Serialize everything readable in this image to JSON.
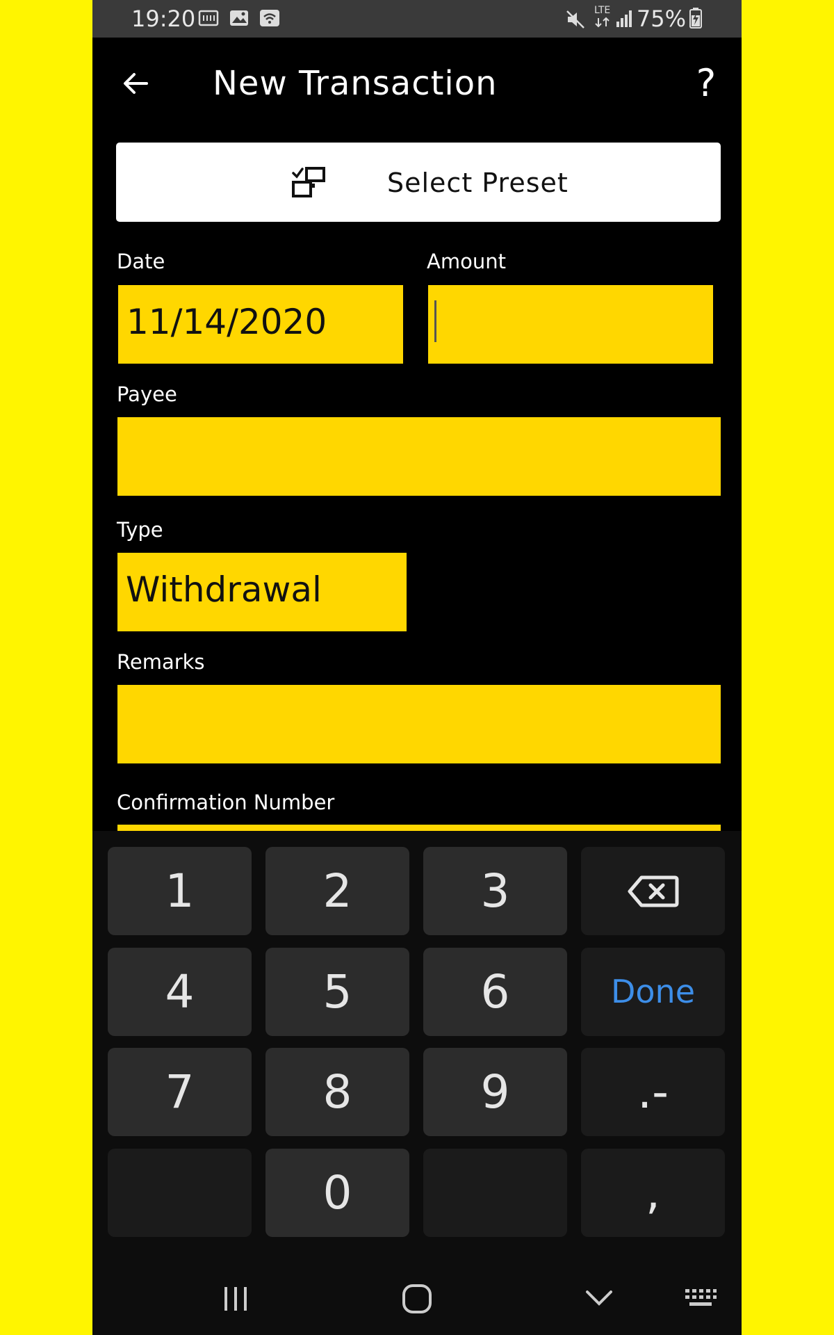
{
  "status_bar": {
    "time": "19:20",
    "network": "LTE",
    "battery": "75%"
  },
  "app_bar": {
    "title": "New Transaction",
    "help_label": "?"
  },
  "preset": {
    "label": "Select Preset"
  },
  "form": {
    "date_label": "Date",
    "date_value": "11/14/2020",
    "amount_label": "Amount",
    "amount_value": "",
    "payee_label": "Payee",
    "payee_value": "",
    "type_label": "Type",
    "type_value": "Withdrawal",
    "remarks_label": "Remarks",
    "remarks_value": "",
    "confirmation_label": "Confirmation Number"
  },
  "keyboard": {
    "keys": [
      "1",
      "2",
      "3",
      "4",
      "5",
      "6",
      "Done",
      "7",
      "8",
      "9",
      ".-",
      "0",
      ","
    ]
  },
  "colors": {
    "background": "#FFF500",
    "field": "#FFD700",
    "done": "#3d8ee8"
  }
}
